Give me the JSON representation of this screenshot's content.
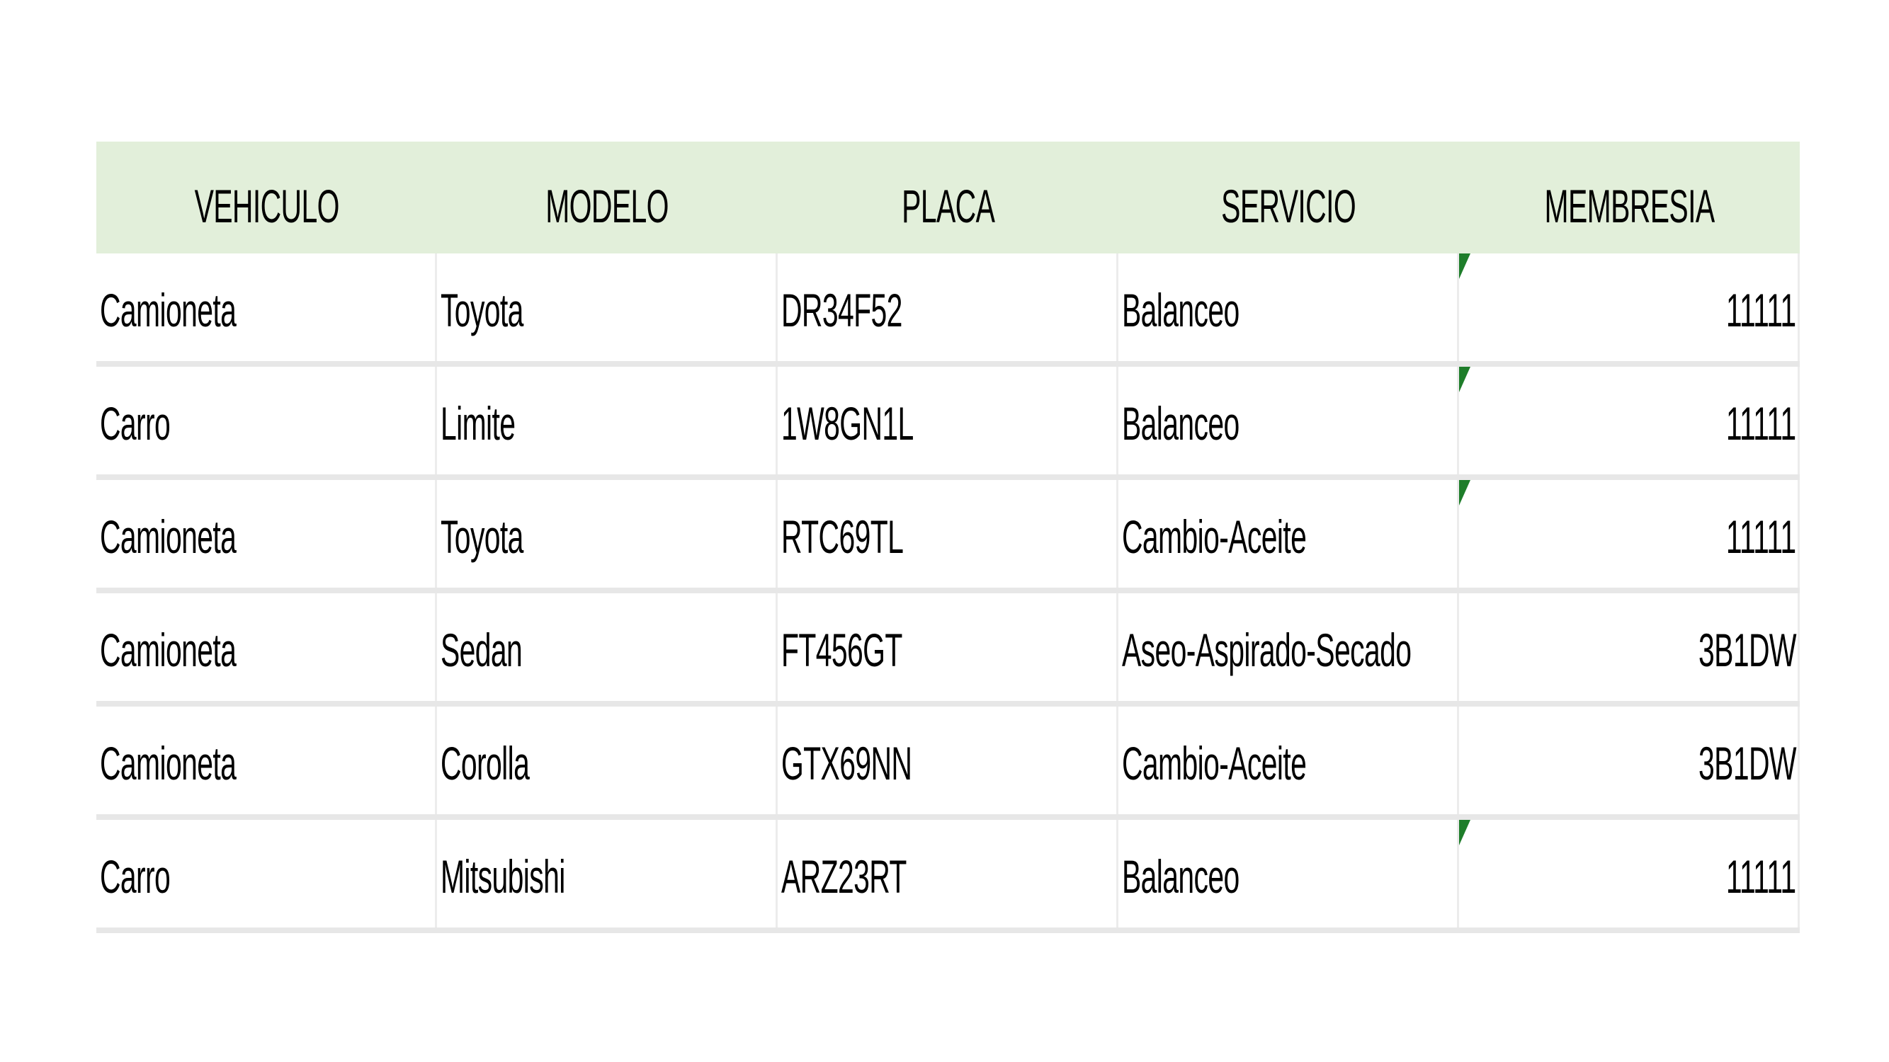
{
  "table": {
    "headers": [
      "VEHICULO",
      "MODELO",
      "PLACA",
      "SERVICIO",
      "MEMBRESIA"
    ],
    "rows": [
      [
        "Camioneta",
        "Toyota",
        "DR34F52",
        "Balanceo",
        "11111"
      ],
      [
        "Carro",
        "Limite",
        "1W8GN1L",
        "Balanceo",
        "11111"
      ],
      [
        "Camioneta",
        "Toyota",
        "RTC69TL",
        "Cambio-Aceite",
        "11111"
      ],
      [
        "Camioneta",
        "Sedan",
        "FT456GT",
        "Aseo-Aspirado-Secado",
        "3B1DW"
      ],
      [
        "Camioneta",
        "Corolla",
        "GTX69NN",
        "Cambio-Aceite",
        "3B1DW"
      ],
      [
        "Carro",
        "Mitsubishi",
        "ARZ23RT",
        "Balanceo",
        "11111"
      ]
    ],
    "number_stored_as_text_marker_rows": [
      0,
      1,
      2,
      5
    ]
  },
  "colors": {
    "header_background": "#e2efda",
    "gridline": "#e7e7e7",
    "error_marker": "#1e7d2a"
  }
}
